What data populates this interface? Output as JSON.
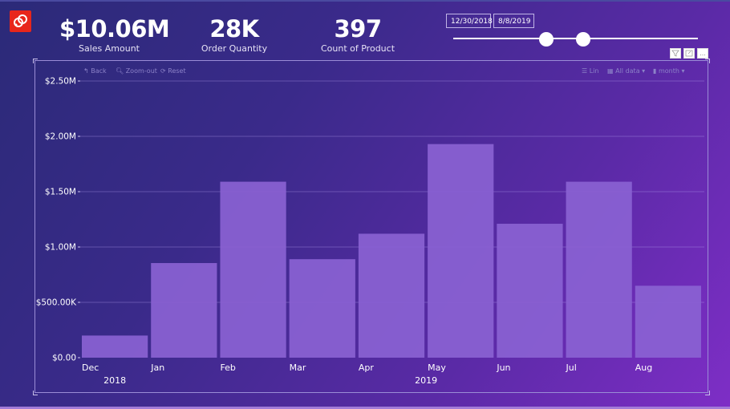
{
  "kpis": [
    {
      "value": "$10.06M",
      "label": "Sales Amount"
    },
    {
      "value": "28K",
      "label": "Order Quantity"
    },
    {
      "value": "397",
      "label": "Count of Product"
    }
  ],
  "date_slicer": {
    "start": "12/30/2018",
    "end": "8/8/2019",
    "start_fraction": 0.38,
    "end_fraction": 0.53
  },
  "visual_header": {
    "filter_icon": "filter-icon",
    "focus_icon": "focus-mode-icon",
    "more_label": "..."
  },
  "toolbar": {
    "back": "Back",
    "zoom_out": "Zoom-out",
    "reset": "Reset",
    "scale": "Lin",
    "data_range": "All data",
    "granularity": "month"
  },
  "colors": {
    "bar": "#8a62d2",
    "logo": "#e8261b"
  },
  "chart_data": {
    "type": "bar",
    "title": "",
    "xlabel": "",
    "ylabel": "Sales Amount",
    "categories": [
      "Dec",
      "Jan",
      "Feb",
      "Mar",
      "Apr",
      "May",
      "Jun",
      "Jul",
      "Aug"
    ],
    "years": [
      {
        "label": "2018",
        "from": 0,
        "to": 0
      },
      {
        "label": "2019",
        "from": 1,
        "to": 8
      }
    ],
    "values": [
      200000,
      855000,
      1590000,
      890000,
      1120000,
      1930000,
      1210000,
      1590000,
      650000
    ],
    "ylim": [
      0,
      2500000
    ],
    "yticks": [
      {
        "value": 0,
        "label": "$0.00"
      },
      {
        "value": 500000,
        "label": "$500.00K"
      },
      {
        "value": 1000000,
        "label": "$1.00M"
      },
      {
        "value": 1500000,
        "label": "$1.50M"
      },
      {
        "value": 2000000,
        "label": "$2.00M"
      },
      {
        "value": 2500000,
        "label": "$2.50M"
      }
    ],
    "grid": true,
    "legend": "none"
  }
}
